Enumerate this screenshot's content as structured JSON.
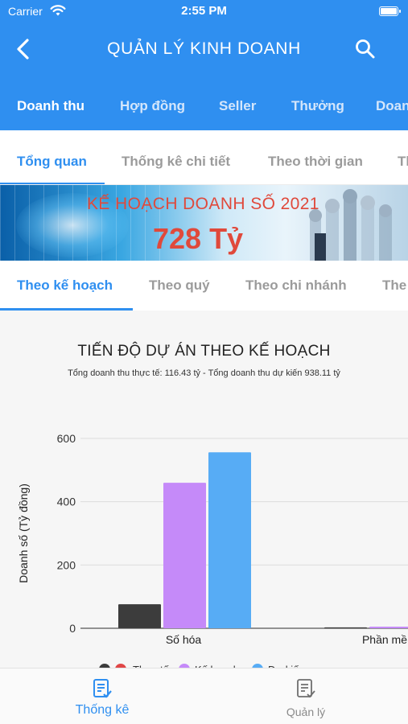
{
  "status_bar": {
    "carrier": "Carrier",
    "time": "2:55 PM"
  },
  "nav": {
    "title": "QUẢN LÝ KINH DOANH",
    "back_icon": "chevron-left-icon",
    "search_icon": "search-icon"
  },
  "main_tabs": [
    "Doanh thu",
    "Hợp đồng",
    "Seller",
    "Thưởng",
    "Doan"
  ],
  "sub_tabs": [
    "Tổng quan",
    "Thống kê chi tiết",
    "Theo thời gian",
    "Th"
  ],
  "banner": {
    "headline": "KẾ HOẠCH DOANH SỐ 2021",
    "amount": "728 Tỷ"
  },
  "plan_tabs": [
    "Theo kế hoạch",
    "Theo quý",
    "Theo chi nhánh",
    "The"
  ],
  "colors": {
    "primary": "#2f8ff0",
    "actual": "#3c3c3c",
    "plan": "#c58af9",
    "forecast": "#57acf5",
    "marker_red": "#e04646"
  },
  "chart_data": {
    "type": "bar",
    "title": "TIẾN ĐỘ DỰ ÁN THEO KẾ HOẠCH",
    "subtitle": "Tổng doanh thu thực tế: 116.43 tỷ - Tổng doanh thu dự kiến 938.11 tỷ",
    "ylabel": "Doanh số (Tỷ đồng)",
    "xlabel": "",
    "ylim": [
      0,
      600
    ],
    "yticks": [
      0,
      200,
      400,
      600
    ],
    "grid": true,
    "categories": [
      "Số hóa",
      "Phần mề"
    ],
    "series": [
      {
        "name": "Thực tế",
        "values": [
          76,
          3
        ]
      },
      {
        "name": "Kế hoạch",
        "values": [
          460,
          5
        ]
      },
      {
        "name": "Dự kiến",
        "values": [
          556,
          0
        ]
      }
    ],
    "legend_position": "bottom",
    "legend_labels_visible": [
      "Thực tế",
      "Kế hoạch",
      "Dự kiến"
    ]
  },
  "bottom_nav": [
    {
      "label": "Thống kê",
      "icon": "statistics-icon"
    },
    {
      "label": "Quản lý",
      "icon": "manage-icon"
    }
  ]
}
